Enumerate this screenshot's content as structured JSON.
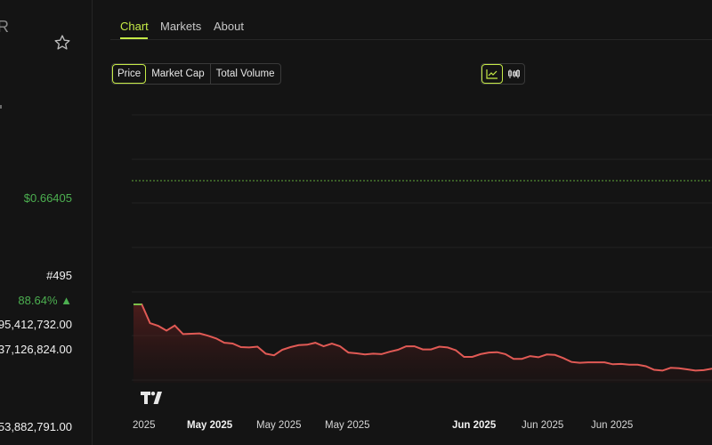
{
  "sidebar": {
    "truncated_heading": "R",
    "price": "$0.66405",
    "rank": "#495",
    "change_percent": "88.64% ▲",
    "value_1": "95,412,732.00",
    "value_2": "37,126,824.00",
    "value_3": "53,882,791.00"
  },
  "tabs": [
    {
      "label": "Chart",
      "active": true
    },
    {
      "label": "Markets",
      "active": false
    },
    {
      "label": "About",
      "active": false
    }
  ],
  "metric_buttons": [
    {
      "label": "Price",
      "active": true
    },
    {
      "label": "Market Cap",
      "active": false
    },
    {
      "label": "Total Volume",
      "active": false
    }
  ],
  "view_toggle": [
    {
      "icon": "line-chart-icon",
      "active": true
    },
    {
      "icon": "candlestick-icon",
      "active": false
    }
  ],
  "colors": {
    "accent": "#c5ea46",
    "positive": "#4caf50",
    "negative_line": "#e15a55",
    "background": "#141414"
  },
  "chart_data": {
    "type": "area",
    "x_tick_labels": [
      "2025",
      "May 2025",
      "May 2025",
      "May 2025",
      "Jun 2025",
      "Jun 2025",
      "Jun 2025"
    ],
    "x_tick_bold": [
      false,
      true,
      false,
      false,
      true,
      false,
      false
    ],
    "reference_line": "dashed green horizontal line",
    "y_values": [
      0.6,
      0.6,
      0.552,
      0.545,
      0.533,
      0.546,
      0.524,
      0.525,
      0.526,
      0.52,
      0.513,
      0.502,
      0.5,
      0.491,
      0.49,
      0.492,
      0.474,
      0.47,
      0.484,
      0.491,
      0.496,
      0.497,
      0.502,
      0.493,
      0.5,
      0.493,
      0.477,
      0.475,
      0.472,
      0.474,
      0.473,
      0.479,
      0.484,
      0.493,
      0.493,
      0.485,
      0.485,
      0.492,
      0.49,
      0.483,
      0.466,
      0.466,
      0.473,
      0.477,
      0.478,
      0.473,
      0.461,
      0.461,
      0.468,
      0.465,
      0.472,
      0.471,
      0.463,
      0.453,
      0.451,
      0.452,
      0.452,
      0.452,
      0.447,
      0.448,
      0.446,
      0.446,
      0.442,
      0.433,
      0.431,
      0.438,
      0.437,
      0.434,
      0.431,
      0.432,
      0.436
    ],
    "series_color": "#e15a55",
    "start_segment_color": "#7cbf4a",
    "grid": true
  }
}
